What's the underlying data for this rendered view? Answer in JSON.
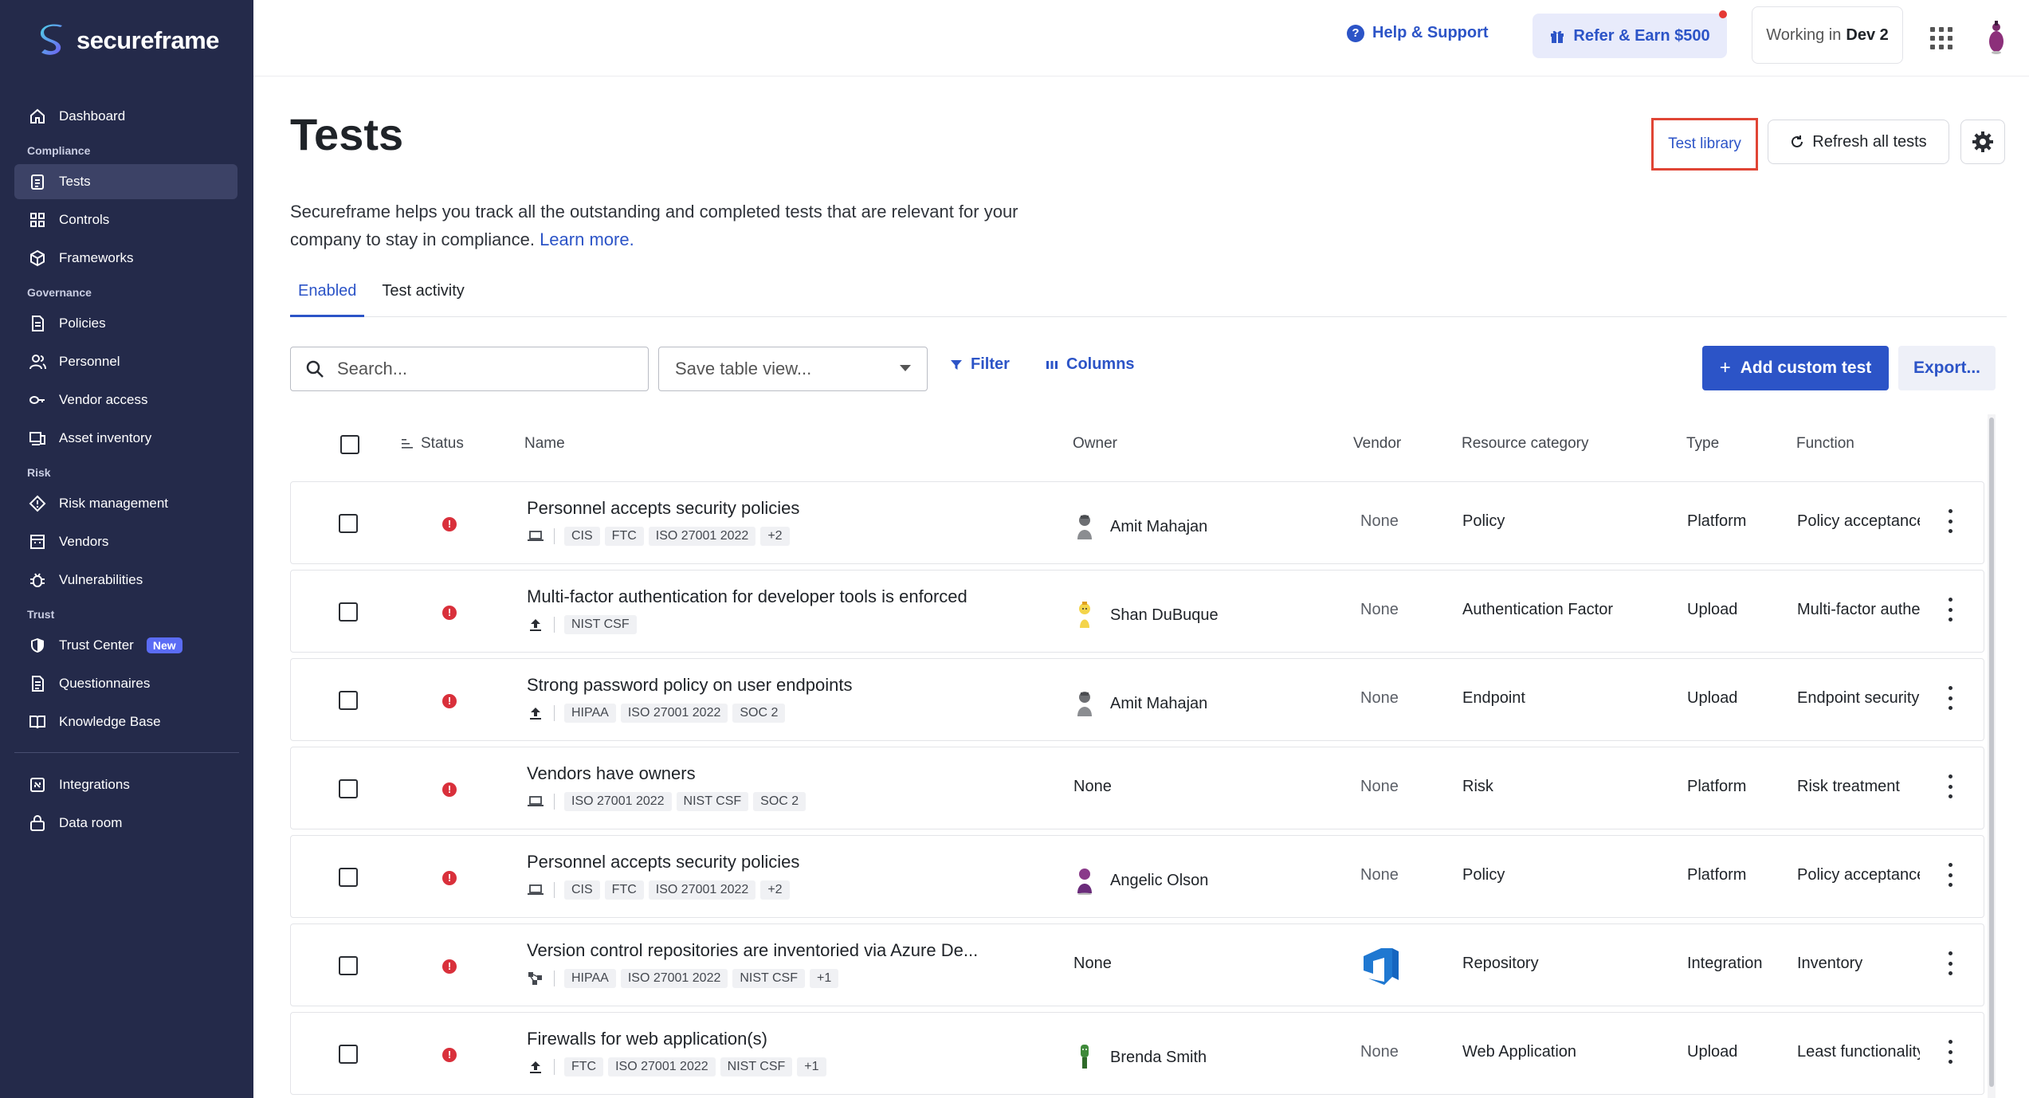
{
  "app": {
    "brand": "secureframe"
  },
  "sidebar": {
    "sections": [
      {
        "label": "",
        "items": [
          {
            "label": "Dashboard",
            "icon": "home-icon"
          }
        ]
      },
      {
        "label": "Compliance",
        "items": [
          {
            "label": "Tests",
            "icon": "clipboard-icon",
            "active": true
          },
          {
            "label": "Controls",
            "icon": "grid-icon"
          },
          {
            "label": "Frameworks",
            "icon": "cube-icon"
          }
        ]
      },
      {
        "label": "Governance",
        "items": [
          {
            "label": "Policies",
            "icon": "document-icon"
          },
          {
            "label": "Personnel",
            "icon": "users-icon"
          },
          {
            "label": "Vendor access",
            "icon": "key-icon"
          },
          {
            "label": "Asset inventory",
            "icon": "devices-icon"
          }
        ]
      },
      {
        "label": "Risk",
        "items": [
          {
            "label": "Risk management",
            "icon": "diamond-icon"
          },
          {
            "label": "Vendors",
            "icon": "building-icon"
          },
          {
            "label": "Vulnerabilities",
            "icon": "bug-icon"
          }
        ]
      },
      {
        "label": "Trust",
        "items": [
          {
            "label": "Trust Center",
            "icon": "shield-icon",
            "badge": "New"
          },
          {
            "label": "Questionnaires",
            "icon": "list-icon"
          },
          {
            "label": "Knowledge Base",
            "icon": "book-icon"
          }
        ]
      }
    ],
    "footer_items": [
      {
        "label": "Integrations",
        "icon": "plug-icon"
      },
      {
        "label": "Data room",
        "icon": "lock-icon"
      }
    ]
  },
  "topbar": {
    "help_label": "Help & Support",
    "refer_label": "Refer & Earn $500",
    "working_prefix": "Working in",
    "workspace": "Dev 2"
  },
  "header": {
    "title": "Tests",
    "description": "Secureframe helps you track all the outstanding and completed tests that are relevant for your company to stay in compliance.",
    "learn_more": "Learn more.",
    "test_library": "Test library",
    "refresh_all": "Refresh all tests"
  },
  "tabs": [
    {
      "label": "Enabled",
      "active": true
    },
    {
      "label": "Test activity",
      "active": false
    }
  ],
  "toolbar": {
    "search_placeholder": "Search...",
    "save_view_placeholder": "Save table view...",
    "filter": "Filter",
    "columns": "Columns",
    "add_custom_test": "Add custom test",
    "export": "Export..."
  },
  "table": {
    "columns": [
      "Status",
      "Name",
      "Owner",
      "Vendor",
      "Resource category",
      "Type",
      "Function"
    ],
    "rows": [
      {
        "name": "Personnel accepts security policies",
        "source_icon": "laptop-icon",
        "tags": [
          "CIS",
          "FTC",
          "ISO 27001 2022",
          "+2"
        ],
        "owner": "Amit Mahajan",
        "owner_avatar": "gray",
        "vendor": "None",
        "resource_category": "Policy",
        "type": "Platform",
        "function": "Policy acceptance"
      },
      {
        "name": "Multi-factor authentication for developer tools is enforced",
        "source_icon": "upload-icon",
        "tags": [
          "NIST CSF"
        ],
        "owner": "Shan DuBuque",
        "owner_avatar": "yellow",
        "vendor": "None",
        "resource_category": "Authentication Factor",
        "type": "Upload",
        "function": "Multi-factor authentication"
      },
      {
        "name": "Strong password policy on user endpoints",
        "source_icon": "upload-icon",
        "tags": [
          "HIPAA",
          "ISO 27001 2022",
          "SOC 2"
        ],
        "owner": "Amit Mahajan",
        "owner_avatar": "gray",
        "vendor": "None",
        "resource_category": "Endpoint",
        "type": "Upload",
        "function": "Endpoint security"
      },
      {
        "name": "Vendors have owners",
        "source_icon": "laptop-icon",
        "tags": [
          "ISO 27001 2022",
          "NIST CSF",
          "SOC 2"
        ],
        "owner": "None",
        "owner_avatar": "",
        "vendor": "None",
        "resource_category": "Risk",
        "type": "Platform",
        "function": "Risk treatment"
      },
      {
        "name": "Personnel accepts security policies",
        "source_icon": "laptop-icon",
        "tags": [
          "CIS",
          "FTC",
          "ISO 27001 2022",
          "+2"
        ],
        "owner": "Angelic Olson",
        "owner_avatar": "purple",
        "vendor": "None",
        "resource_category": "Policy",
        "type": "Platform",
        "function": "Policy acceptance"
      },
      {
        "name": "Version control repositories are inventoried via Azure De...",
        "source_icon": "integration-icon",
        "tags": [
          "HIPAA",
          "ISO 27001 2022",
          "NIST CSF",
          "+1"
        ],
        "owner": "None",
        "owner_avatar": "",
        "vendor": "azure-devops-logo",
        "resource_category": "Repository",
        "type": "Integration",
        "function": "Inventory"
      },
      {
        "name": "Firewalls for web application(s)",
        "source_icon": "upload-icon",
        "tags": [
          "FTC",
          "ISO 27001 2022",
          "NIST CSF",
          "+1"
        ],
        "owner": "Brenda Smith",
        "owner_avatar": "green",
        "vendor": "None",
        "resource_category": "Web Application",
        "type": "Upload",
        "function": "Least functionality"
      }
    ]
  },
  "colors": {
    "sidebar": "#242a4a",
    "accent": "#2c54c7",
    "status_fail": "#d9303b",
    "highlight": "#e04535"
  }
}
